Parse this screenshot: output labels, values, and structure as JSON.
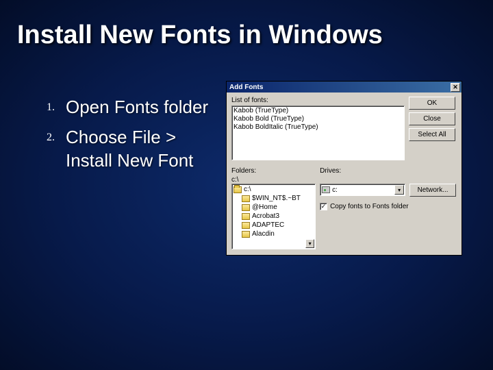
{
  "slide": {
    "title": "Install New Fonts in Windows",
    "steps": [
      {
        "num": "1.",
        "text": "Open Fonts folder"
      },
      {
        "num": "2.",
        "text": "Choose File > Install New Font"
      }
    ]
  },
  "dialog": {
    "title": "Add Fonts",
    "close_glyph": "✕",
    "fonts_label": "List of fonts:",
    "fonts": [
      "Kabob (TrueType)",
      "Kabob Bold (TrueType)",
      "Kabob BoldItalic (TrueType)"
    ],
    "buttons": {
      "ok": "OK",
      "close": "Close",
      "select_all": "Select All",
      "network": "Network..."
    },
    "folders_label": "Folders:",
    "current_path": "c:\\",
    "folders": [
      "c:\\",
      "$WIN_NT$.~BT",
      "@Home",
      "Acrobat3",
      "ADAPTEC",
      "Alacdin"
    ],
    "drives_label": "Drives:",
    "drive_value": "c:",
    "copy_checkbox": {
      "label": "Copy fonts to Fonts folder",
      "checked": true
    }
  }
}
